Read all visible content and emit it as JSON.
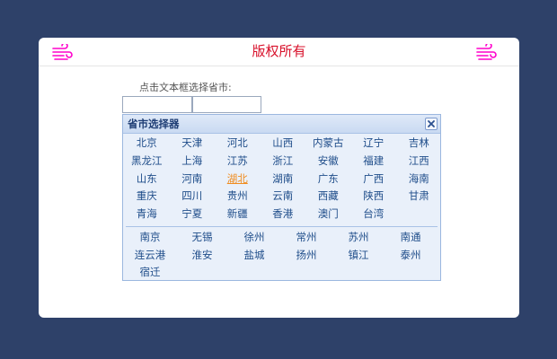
{
  "page": {
    "title": "版权所有"
  },
  "icons": {
    "left": "wind-icon",
    "right": "wind-icon",
    "color": "#ff00cc"
  },
  "form": {
    "prompt": "点击文本框选择省市:",
    "province_value": "",
    "city_value": ""
  },
  "selector": {
    "title": "省市选择器",
    "close_icon": "close-icon",
    "selected_province": "湖北",
    "provinces": [
      "北京",
      "天津",
      "河北",
      "山西",
      "内蒙古",
      "辽宁",
      "吉林",
      "黑龙江",
      "上海",
      "江苏",
      "浙江",
      "安徽",
      "福建",
      "江西",
      "山东",
      "河南",
      "湖北",
      "湖南",
      "广东",
      "广西",
      "海南",
      "重庆",
      "四川",
      "贵州",
      "云南",
      "西藏",
      "陕西",
      "甘肃",
      "青海",
      "宁夏",
      "新疆",
      "香港",
      "澳门",
      "台湾"
    ],
    "cities": [
      "南京",
      "无锡",
      "徐州",
      "常州",
      "苏州",
      "南通",
      "连云港",
      "淮安",
      "盐城",
      "扬州",
      "镇江",
      "泰州",
      "宿迁"
    ]
  },
  "colors": {
    "background": "#2e4169",
    "title": "#d8112b",
    "link": "#1f4d8a",
    "selected": "#f08c1e",
    "panel": "#e9f0fa"
  }
}
